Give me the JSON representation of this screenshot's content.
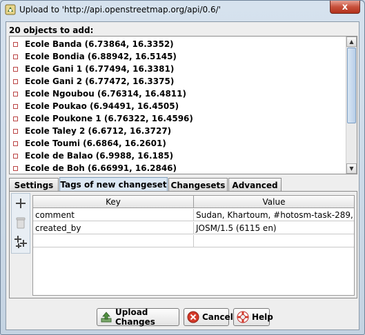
{
  "window": {
    "title": "Upload to 'http://api.openstreetmap.org/api/0.6/'",
    "close_glyph": "x"
  },
  "objects": {
    "heading": "20 objects to add:",
    "items": [
      "Ecole Banda (6.73864, 16.3352)",
      "Ecole Bondia (6.88942, 16.5145)",
      "Ecole Gani 1 (6.77494, 16.3381)",
      "Ecole Gani 2 (6.77472, 16.3375)",
      "Ecole Ngoubou (6.76314, 16.4811)",
      "Ecole Poukao (6.94491, 16.4505)",
      "Ecole Poukone 1 (6.76322, 16.4596)",
      "Ecole Taley 2 (6.6712, 16.3727)",
      "Ecole Toumi (6.6864, 16.2601)",
      "Ecole de Balao (6.9988, 16.185)",
      "Ecole de Boh (6.66991, 16.2846)"
    ],
    "scroll_up_glyph": "▲",
    "scroll_down_glyph": "▼"
  },
  "tabs": [
    {
      "label": "Settings",
      "active": false
    },
    {
      "label": "Tags of new changeset",
      "active": true
    },
    {
      "label": "Changesets",
      "active": false
    },
    {
      "label": "Advanced",
      "active": false
    }
  ],
  "tags_table": {
    "headers": {
      "key": "Key",
      "value": "Value"
    },
    "rows": [
      {
        "key": "comment",
        "value": "Sudan, Khartoum, #hotosm-task-289, ..."
      },
      {
        "key": "created_by",
        "value": "JOSM/1.5 (6115 en)"
      },
      {
        "key": "",
        "value": ""
      }
    ]
  },
  "side_tools": [
    {
      "icon": "add-icon"
    },
    {
      "icon": "delete-icon"
    },
    {
      "icon": "add-all-icon"
    }
  ],
  "buttons": {
    "upload": "Upload Changes",
    "cancel": "Cancel",
    "help": "Help"
  },
  "colors": {
    "accent": "#7f9db9",
    "cancel_red": "#d43a2a",
    "node_red": "#bb4444"
  }
}
